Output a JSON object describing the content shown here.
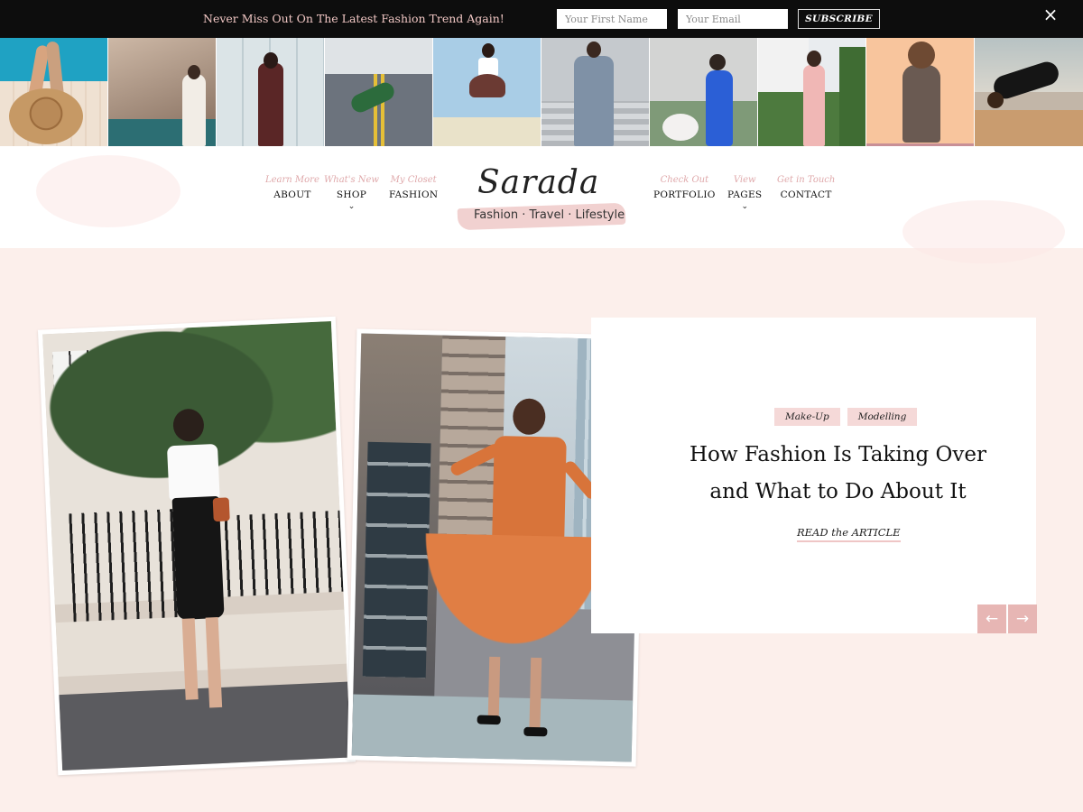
{
  "topbar": {
    "message": "Never Miss Out On The Latest Fashion Trend Again!",
    "first_name_placeholder": "Your First Name",
    "email_placeholder": "Your Email",
    "subscribe_label": "SUBSCRIBE",
    "close_icon": "×"
  },
  "strip": [
    {
      "name": "pool-hat",
      "bg": "#2aa6c2",
      "accent": "#b0845a"
    },
    {
      "name": "coast-rocks",
      "bg": "#a98d7a",
      "accent": "#f3efe9"
    },
    {
      "name": "glass-building",
      "bg": "#dfe6e8",
      "accent": "#5c2b2a"
    },
    {
      "name": "road",
      "bg": "#6f7682",
      "accent": "#e9c43b"
    },
    {
      "name": "jump-sky",
      "bg": "#a9cde6",
      "accent": "#5a2f2a"
    },
    {
      "name": "stairs",
      "bg": "#b7bec6",
      "accent": "#7d8fa6"
    },
    {
      "name": "field",
      "bg": "#c8c9c9",
      "accent": "#2b5fd6"
    },
    {
      "name": "greenery",
      "bg": "#a7b8a0",
      "accent": "#f0b7b5"
    },
    {
      "name": "peach-wall",
      "bg": "#f6c49c",
      "accent": "#55453f"
    },
    {
      "name": "beach",
      "bg": "#b4b3ad",
      "accent": "#151515"
    }
  ],
  "nav": {
    "left": [
      {
        "sub": "Learn More",
        "label": "ABOUT",
        "dropdown": false
      },
      {
        "sub": "What's New",
        "label": "SHOP",
        "dropdown": true
      },
      {
        "sub": "My Closet",
        "label": "FASHION",
        "dropdown": false
      }
    ],
    "right": [
      {
        "sub": "Check Out",
        "label": "PORTFOLIO",
        "dropdown": false
      },
      {
        "sub": "View",
        "label": "PAGES",
        "dropdown": true
      },
      {
        "sub": "Get in Touch",
        "label": "CONTACT",
        "dropdown": false
      }
    ],
    "chevron": "⌄"
  },
  "logo": {
    "name": "Sarada",
    "tagline": "Fashion · Travel · Lifestyle"
  },
  "featured": {
    "tags": [
      "Make-Up",
      "Modelling"
    ],
    "headline_line1": "How Fashion Is Taking Over",
    "headline_line2": "and What to Do About It",
    "read_more": "READ the ARTICLE"
  },
  "slider": {
    "prev_icon": "←",
    "next_icon": "→"
  },
  "colors": {
    "background": "#fcefeb",
    "accent_pink": "#e7b6b4",
    "topbar": "#0d0d0d"
  }
}
